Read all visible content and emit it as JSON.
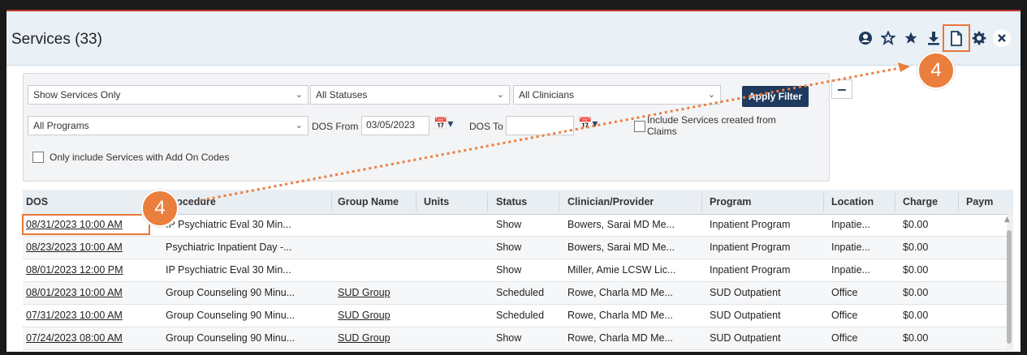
{
  "header": {
    "title": "Services (33)"
  },
  "toolbar": {
    "icons": [
      "user-icon",
      "star-outline-icon",
      "star-icon",
      "download-icon",
      "new-document-icon",
      "gear-icon",
      "close-icon"
    ]
  },
  "callouts": {
    "top": "4",
    "row": "4"
  },
  "filters": {
    "service_type": "Show Services Only",
    "status": "All Statuses",
    "clinicians": "All Clinicians",
    "programs": "All Programs",
    "dos_from_label": "DOS From",
    "dos_from_value": "03/05/2023",
    "dos_to_label": "DOS To",
    "dos_to_value": "",
    "include_claims_label": "Include Services created from Claims",
    "add_on_codes_label": "Only include Services with Add On Codes",
    "apply_label": "Apply Filter",
    "collapse_label": "−"
  },
  "grid": {
    "columns": [
      "DOS",
      "Procedure",
      "Group Name",
      "Units",
      "Status",
      "Clinician/Provider",
      "Program",
      "Location",
      "Charge",
      "Paym"
    ],
    "rows": [
      {
        "dos": "08/31/2023 10:00 AM",
        "procedure": "IP Psychiatric Eval 30 Min...",
        "group": "",
        "units": "",
        "status": "Show",
        "clinician": "Bowers, Sarai MD Me...",
        "program": "Inpatient Program",
        "location": "Inpatie...",
        "charge": "$0.00"
      },
      {
        "dos": "08/23/2023 10:00 AM",
        "procedure": "Psychiatric Inpatient Day -...",
        "group": "",
        "units": "",
        "status": "Show",
        "clinician": "Bowers, Sarai MD Me...",
        "program": "Inpatient Program",
        "location": "Inpatie...",
        "charge": "$0.00"
      },
      {
        "dos": "08/01/2023 12:00 PM",
        "procedure": "IP Psychiatric Eval 30 Min...",
        "group": "",
        "units": "",
        "status": "Show",
        "clinician": "Miller, Amie LCSW Lic...",
        "program": "Inpatient Program",
        "location": "Inpatie...",
        "charge": "$0.00"
      },
      {
        "dos": "08/01/2023 10:00 AM",
        "procedure": "Group Counseling 90 Minu...",
        "group": "SUD Group",
        "units": "",
        "status": "Scheduled",
        "clinician": "Rowe, Charla MD Me...",
        "program": "SUD Outpatient",
        "location": "Office",
        "charge": "$0.00"
      },
      {
        "dos": "07/31/2023 10:00 AM",
        "procedure": "Group Counseling 90 Minu...",
        "group": "SUD Group",
        "units": "",
        "status": "Scheduled",
        "clinician": "Rowe, Charla MD Me...",
        "program": "SUD Outpatient",
        "location": "Office",
        "charge": "$0.00"
      },
      {
        "dos": "07/24/2023 08:00 AM",
        "procedure": "Group Counseling 90 Minu...",
        "group": "SUD Group",
        "units": "",
        "status": "Show",
        "clinician": "Rowe, Charla MD Me...",
        "program": "SUD Outpatient",
        "location": "Office",
        "charge": "$0.00"
      }
    ]
  },
  "colors": {
    "accent": "#1f3a5f",
    "callout": "#ea7e3d",
    "header_bg": "#e9f0f6"
  }
}
